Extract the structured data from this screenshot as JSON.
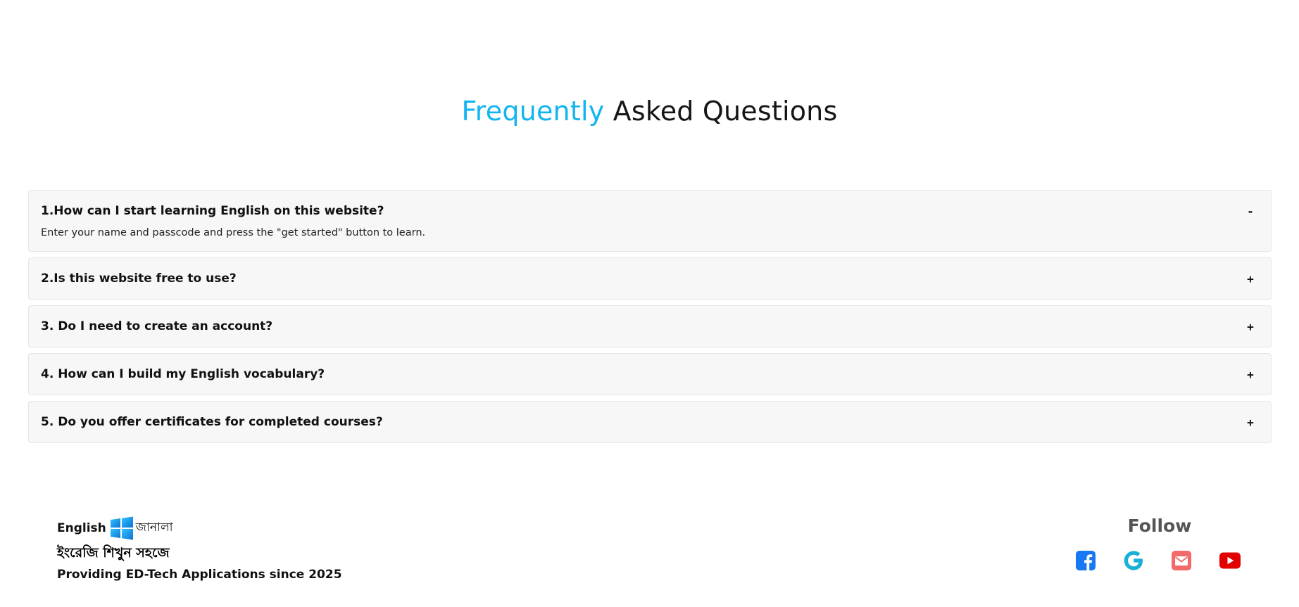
{
  "faq": {
    "title_accent": "Frequently",
    "title_rest": "Asked Questions",
    "items": [
      {
        "question": "1.How can I start learning English on this website?",
        "toggle": "-",
        "answer": "Enter your name and passcode and press the \"get started\" button to learn.",
        "open": true
      },
      {
        "question": "2.Is this website free to use?",
        "toggle": "+",
        "open": false
      },
      {
        "question": "3. Do I need to create an account?",
        "toggle": "+",
        "open": false
      },
      {
        "question": "4. How can I build my English vocabulary?",
        "toggle": "+",
        "open": false
      },
      {
        "question": "5. Do you offer certificates for completed courses?",
        "toggle": "+",
        "open": false
      }
    ]
  },
  "footer": {
    "brand_en": "English",
    "brand_bn": "জানালা",
    "tagline_bn": "ইংরেজি শিখুন সহজে",
    "tagline_en": "Providing ED-Tech Applications since 2025",
    "follow_title": "Follow",
    "social": [
      {
        "icon": "facebook-icon",
        "color": "#1877f2"
      },
      {
        "icon": "google-icon",
        "color": "#1ab0d6"
      },
      {
        "icon": "email-icon",
        "color": "#f26b6b"
      },
      {
        "icon": "youtube-icon",
        "color": "#e00000"
      }
    ]
  },
  "colors": {
    "accent": "#12b5f0",
    "card_bg": "#f7f7f7",
    "card_border": "#e6e6e6"
  }
}
